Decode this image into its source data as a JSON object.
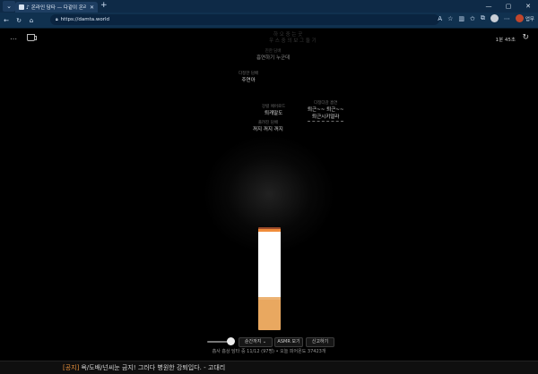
{
  "browser": {
    "menu_icon": "chevron-down-icon",
    "tab_title": "온라인 담타 — 다같이 온라인",
    "url": "https://damta.world",
    "work_label": "업무"
  },
  "header": {
    "timer": "1분 45초"
  },
  "messages": [
    {
      "nick": "",
      "text": "하 오 중 는 곳",
      "style": "faded"
    },
    {
      "nick": "",
      "text": "우 스 중 의 보 그 둘 기",
      "style": "faded"
    },
    {
      "nick": "진한 담배",
      "text": "흡연하기 누군데",
      "style": "semi"
    },
    {
      "nick": "다정한 담배",
      "text": "주연아",
      "style": "normal"
    },
    {
      "nick": "강렬 에어로드",
      "text": "퇴캐말도",
      "style": "normal"
    },
    {
      "nick": "다정다감 흡연",
      "text": "퇴근~~ 퇴근~~",
      "style": "normal"
    },
    {
      "nick": "",
      "text": "퇴근시키얼라",
      "style": "normal"
    },
    {
      "nick": "풀려진 담배",
      "text": "꺼지 꺼지 꺼지",
      "style": "normal"
    }
  ],
  "cigarette": {
    "paper_remaining": 0.66
  },
  "controls": {
    "mode_label": "순간까지 ⌄",
    "size_label": "ASMR 모기",
    "new_label": "신고하기"
  },
  "stats": "흡사 흡상 담타 중 11/12 (97명) • 오늘 피어온도 37423개",
  "notice": {
    "tag": "[공지]",
    "text": "욕/도배/넌씨눈 금지! 그러다 병원한 강퇴입다. - 고대리"
  }
}
